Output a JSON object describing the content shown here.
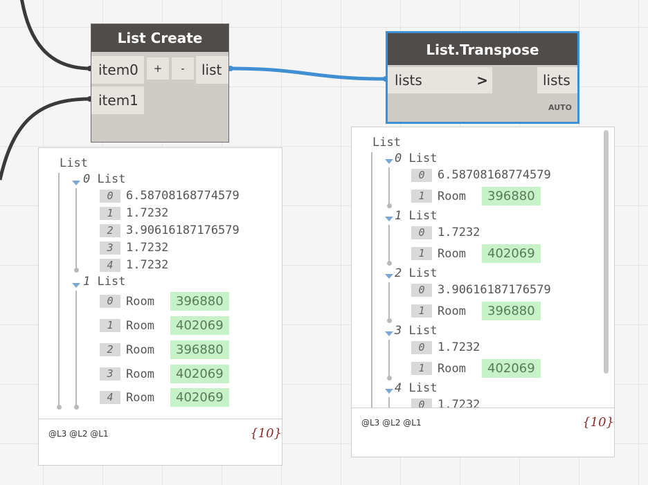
{
  "colors": {
    "wire": "#3f8fd2",
    "wire_dark": "#3a3a3a",
    "selected": "#3f8fd2",
    "value_bg": "#c7f2c7"
  },
  "list_create": {
    "title": "List Create",
    "inputs": [
      "item0",
      "item1"
    ],
    "add_label": "+",
    "remove_label": "-",
    "output": "list"
  },
  "transpose": {
    "title": "List.Transpose",
    "input": "lists",
    "chevron": ">",
    "output": "lists",
    "lacing": "AUTO"
  },
  "preview_left": {
    "root": "List",
    "groups": [
      {
        "index": "0",
        "label": "List",
        "items": [
          {
            "i": "0",
            "v": "6.58708168774579"
          },
          {
            "i": "1",
            "v": "1.7232"
          },
          {
            "i": "2",
            "v": "3.90616187176579"
          },
          {
            "i": "3",
            "v": "1.7232"
          },
          {
            "i": "4",
            "v": "1.7232"
          }
        ]
      },
      {
        "index": "1",
        "label": "List",
        "items": [
          {
            "i": "0",
            "t": "Room",
            "v": "396880"
          },
          {
            "i": "1",
            "t": "Room",
            "v": "402069"
          },
          {
            "i": "2",
            "t": "Room",
            "v": "396880"
          },
          {
            "i": "3",
            "t": "Room",
            "v": "402069"
          },
          {
            "i": "4",
            "t": "Room",
            "v": "402069"
          }
        ]
      }
    ],
    "levels": "@L3 @L2 @L1",
    "count": "{10}"
  },
  "preview_right": {
    "root": "List",
    "groups": [
      {
        "index": "0",
        "label": "List",
        "items": [
          {
            "i": "0",
            "v": "6.58708168774579"
          },
          {
            "i": "1",
            "t": "Room",
            "v": "396880"
          }
        ]
      },
      {
        "index": "1",
        "label": "List",
        "items": [
          {
            "i": "0",
            "v": "1.7232"
          },
          {
            "i": "1",
            "t": "Room",
            "v": "402069"
          }
        ]
      },
      {
        "index": "2",
        "label": "List",
        "items": [
          {
            "i": "0",
            "v": "3.90616187176579"
          },
          {
            "i": "1",
            "t": "Room",
            "v": "396880"
          }
        ]
      },
      {
        "index": "3",
        "label": "List",
        "items": [
          {
            "i": "0",
            "v": "1.7232"
          },
          {
            "i": "1",
            "t": "Room",
            "v": "402069"
          }
        ]
      },
      {
        "index": "4",
        "label": "List",
        "items": [
          {
            "i": "0",
            "v": "1.7232"
          }
        ]
      }
    ],
    "levels": "@L3 @L2 @L1",
    "count": "{10}"
  }
}
